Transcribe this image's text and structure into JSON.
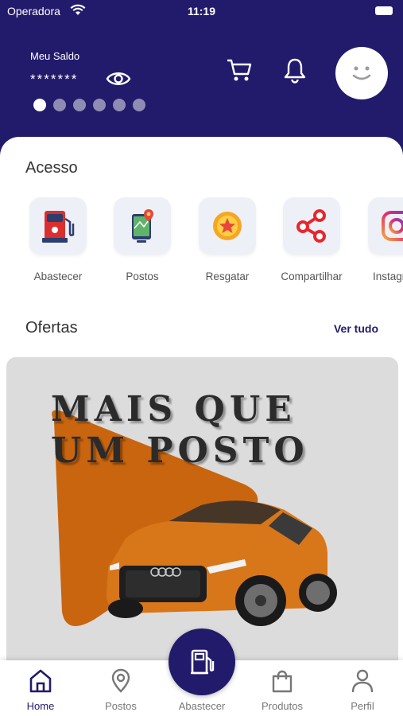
{
  "status_bar": {
    "carrier": "Operadora",
    "time": "11:19"
  },
  "header": {
    "balance_label": "Meu Saldo",
    "balance_value": "*******",
    "carousel_dots": 6,
    "active_dot": 0
  },
  "access": {
    "title": "Acesso",
    "items": [
      {
        "label": "Abastecer",
        "icon": "fuel-pump-icon"
      },
      {
        "label": "Postos",
        "icon": "map-pin-icon"
      },
      {
        "label": "Resgatar",
        "icon": "coin-icon"
      },
      {
        "label": "Compartilhar",
        "icon": "share-icon"
      },
      {
        "label": "Instagram",
        "icon": "instagram-icon"
      }
    ]
  },
  "offers": {
    "title": "Ofertas",
    "see_all": "Ver tudo",
    "banner_text": [
      "MAIS QUE",
      "UM POSTO"
    ]
  },
  "bottom_nav": {
    "items": [
      {
        "label": "Home",
        "icon": "home-icon",
        "active": true
      },
      {
        "label": "Postos",
        "icon": "location-icon",
        "active": false
      },
      {
        "label": "Abastecer",
        "icon": "fuel-icon",
        "active": false
      },
      {
        "label": "Produtos",
        "icon": "shopping-bag-icon",
        "active": false
      },
      {
        "label": "Perfil",
        "icon": "user-icon",
        "active": false
      }
    ]
  },
  "colors": {
    "primary": "#221b6c",
    "banner_orange": "#c9650f",
    "car_orange": "#d8761a"
  }
}
